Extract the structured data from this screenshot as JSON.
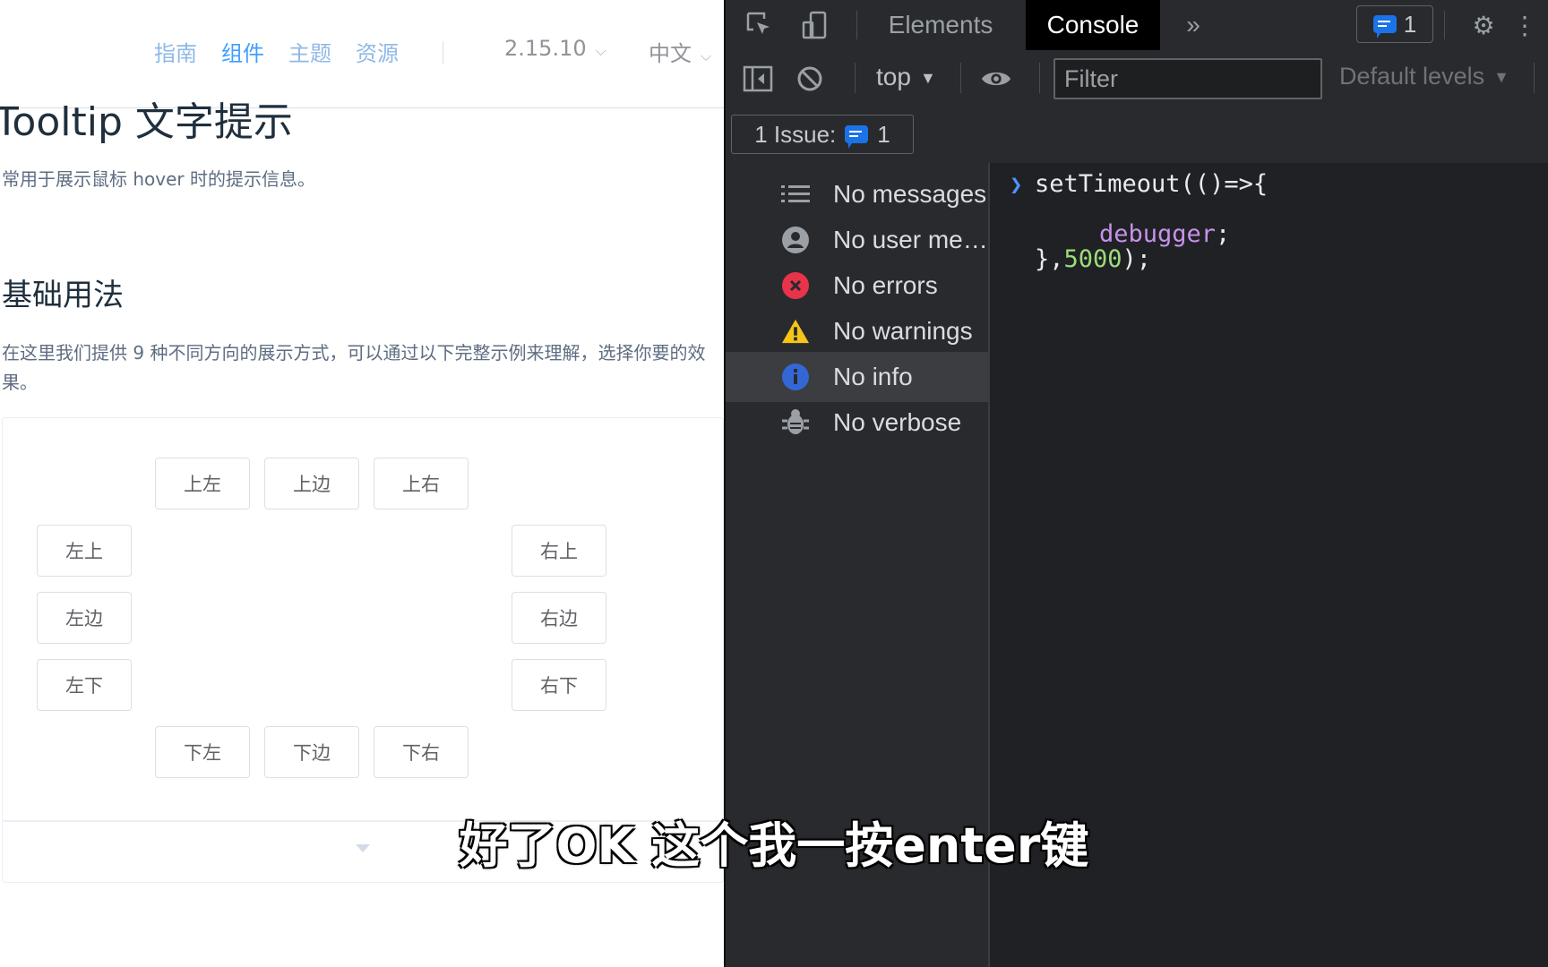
{
  "nav": {
    "items": [
      "指南",
      "组件",
      "主题",
      "资源"
    ],
    "version": "2.15.10",
    "language": "中文"
  },
  "doc": {
    "title": "Tooltip 文字提示",
    "description": "常用于展示鼠标 hover 时的提示信息。",
    "section_title": "基础用法",
    "section_desc": "在这里我们提供 9 种不同方向的展示方式，可以通过以下完整示例来理解，选择你要的效果。"
  },
  "demo": {
    "buttons": {
      "top_start": "上左",
      "top": "上边",
      "top_end": "上右",
      "left_start": "左上",
      "left": "左边",
      "left_end": "左下",
      "right_start": "右上",
      "right": "右边",
      "right_end": "右下",
      "bottom_start": "下左",
      "bottom": "下边",
      "bottom_end": "下右"
    }
  },
  "devtools": {
    "tabs": [
      "Elements",
      "Console"
    ],
    "active_tab": "Console",
    "issues_count": "1",
    "context": "top",
    "filter_placeholder": "Filter",
    "levels": "Default levels",
    "issue_bar": "1 Issue:",
    "issue_bar_count": "1",
    "sidebar": [
      {
        "label": "No messages",
        "icon": "list-icon"
      },
      {
        "label": "No user me…",
        "icon": "user-icon"
      },
      {
        "label": "No errors",
        "icon": "error-icon"
      },
      {
        "label": "No warnings",
        "icon": "warning-icon"
      },
      {
        "label": "No info",
        "icon": "info-icon",
        "selected": true
      },
      {
        "label": "No verbose",
        "icon": "bug-icon"
      }
    ],
    "console": {
      "line1": "setTimeout(()=>{",
      "line2_kw": "debugger",
      "line2_rest": ";",
      "line3_a": "},",
      "line3_num": "5000",
      "line3_b": ");"
    },
    "colors": {
      "accent": "#1a73e8",
      "error": "#e8344a",
      "warning": "#f5c518",
      "info": "#3367d6"
    }
  },
  "subtitle": "好了OK 这个我一按enter键"
}
